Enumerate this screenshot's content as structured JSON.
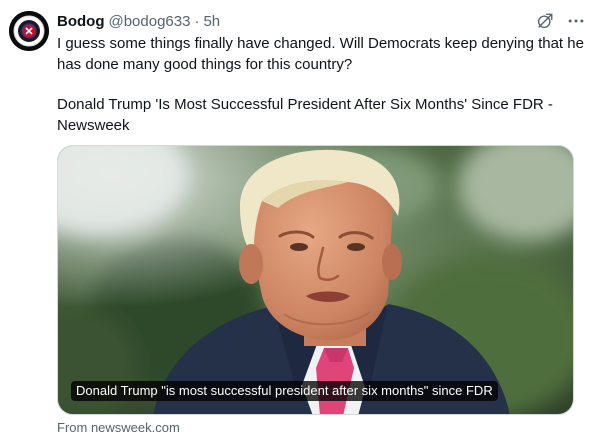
{
  "author": {
    "display_name": "Bodog",
    "handle": "@bodog633",
    "separator": "·",
    "time": "5h",
    "avatar_icon": "bodog-logo-badge"
  },
  "header_icons": {
    "grok": "grok-icon",
    "more": "more-icon"
  },
  "tweet": {
    "paragraphs": [
      "I guess some things finally have changed. Will Democrats keep denying that he has done many good things for this country?",
      "Donald Trump 'Is Most Successful President After Six Months' Since FDR - Newsweek"
    ]
  },
  "card": {
    "image_description_icon": "news-photo",
    "title": "Donald Trump \"is most successful president after six months\" since FDR",
    "source": "From newsweek.com"
  },
  "colors": {
    "text_primary": "#0f1419",
    "text_secondary": "#536471",
    "border": "#cfd9de",
    "avatar_bg": "#0b0b0b"
  }
}
